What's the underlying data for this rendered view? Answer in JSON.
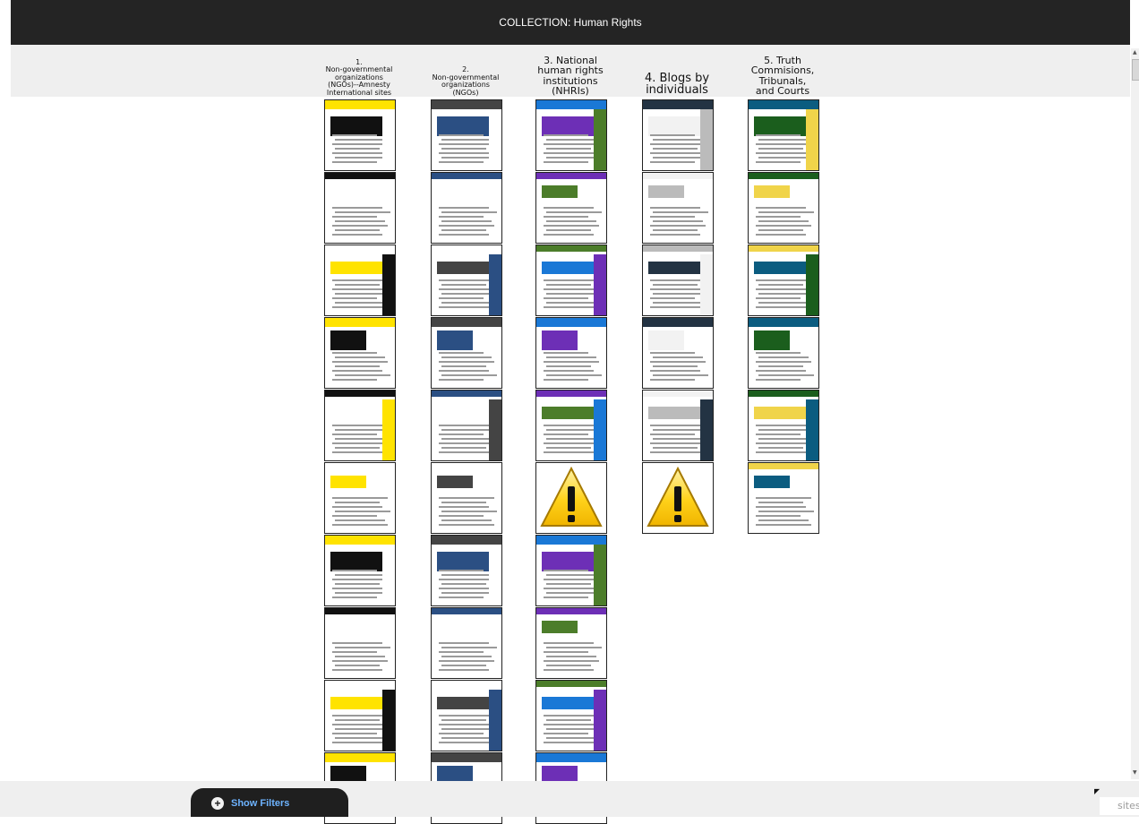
{
  "header": {
    "title": "COLLECTION: Human Rights"
  },
  "columns": [
    {
      "title_lines": [
        "1.",
        "Non-governmental",
        "organizations",
        "(NGOs)--Amnesty",
        "International sites"
      ],
      "style": "small",
      "thumb_count": 10,
      "warning_indexes": [],
      "theme": [
        "#ffe300",
        "#111111",
        "#ffffff"
      ]
    },
    {
      "title_lines": [
        "2.",
        "Non-governmental",
        "organizations",
        "(NGOs)"
      ],
      "style": "small",
      "thumb_count": 10,
      "warning_indexes": [],
      "theme": [
        "#444444",
        "#2b4f83",
        "#ffffff"
      ]
    },
    {
      "title_lines": [
        "3. National",
        "human rights",
        "institutions",
        "(NHRIs)"
      ],
      "style": "med",
      "thumb_count": 10,
      "warning_indexes": [
        5
      ],
      "theme": [
        "#1a78d6",
        "#6d2fb6",
        "#4c7d2a"
      ]
    },
    {
      "title_lines": [
        "4. Blogs by",
        "individuals"
      ],
      "style": "large",
      "thumb_count": 6,
      "warning_indexes": [
        5
      ],
      "theme": [
        "#233343",
        "#f2f2f2",
        "#bbbbbb"
      ]
    },
    {
      "title_lines": [
        "5. Truth",
        "Commisions,",
        "Tribunals,",
        "and Courts"
      ],
      "style": "med",
      "thumb_count": 6,
      "warning_indexes": [],
      "theme": [
        "#0b5c80",
        "#1b5e1d",
        "#f0d44a"
      ]
    }
  ],
  "footer": {
    "filters_label": "Show Filters",
    "sites_text": "sites"
  },
  "icons": {
    "plus": "+",
    "warning": "!"
  }
}
